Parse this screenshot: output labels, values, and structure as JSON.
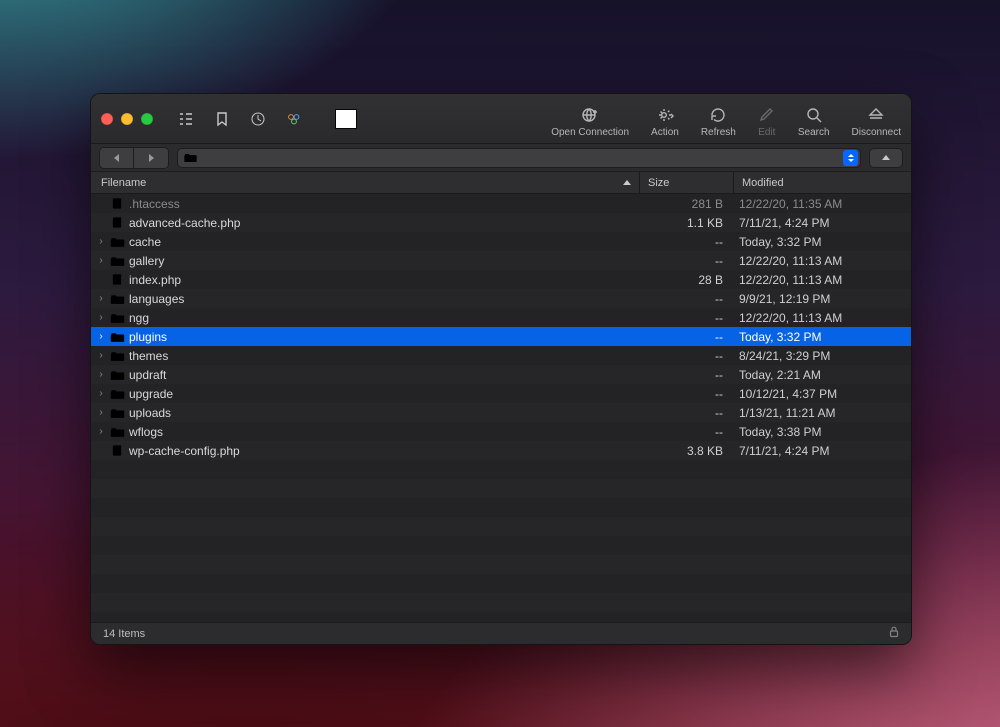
{
  "toolbar": {
    "open_connection": "Open Connection",
    "action": "Action",
    "refresh": "Refresh",
    "edit": "Edit",
    "search": "Search",
    "disconnect": "Disconnect"
  },
  "columns": {
    "filename": "Filename",
    "size": "Size",
    "modified": "Modified"
  },
  "files": [
    {
      "name": ".htaccess",
      "type": "file",
      "size": "281 B",
      "modified": "12/22/20, 11:35 AM",
      "dimmed": true
    },
    {
      "name": "advanced-cache.php",
      "type": "file",
      "size": "1.1 KB",
      "modified": "7/11/21, 4:24 PM"
    },
    {
      "name": "cache",
      "type": "folder",
      "size": "--",
      "modified": "Today, 3:32 PM"
    },
    {
      "name": "gallery",
      "type": "folder",
      "size": "--",
      "modified": "12/22/20, 11:13 AM"
    },
    {
      "name": "index.php",
      "type": "file",
      "size": "28 B",
      "modified": "12/22/20, 11:13 AM"
    },
    {
      "name": "languages",
      "type": "folder",
      "size": "--",
      "modified": "9/9/21, 12:19 PM"
    },
    {
      "name": "ngg",
      "type": "folder",
      "size": "--",
      "modified": "12/22/20, 11:13 AM"
    },
    {
      "name": "plugins",
      "type": "folder",
      "size": "--",
      "modified": "Today, 3:32 PM",
      "selected": true
    },
    {
      "name": "themes",
      "type": "folder",
      "size": "--",
      "modified": "8/24/21, 3:29 PM"
    },
    {
      "name": "updraft",
      "type": "folder",
      "size": "--",
      "modified": "Today, 2:21 AM"
    },
    {
      "name": "upgrade",
      "type": "folder",
      "size": "--",
      "modified": "10/12/21, 4:37 PM"
    },
    {
      "name": "uploads",
      "type": "folder",
      "size": "--",
      "modified": "1/13/21, 11:21 AM"
    },
    {
      "name": "wflogs",
      "type": "folder",
      "size": "--",
      "modified": "Today, 3:38 PM"
    },
    {
      "name": "wp-cache-config.php",
      "type": "file",
      "size": "3.8 KB",
      "modified": "7/11/21, 4:24 PM"
    }
  ],
  "status": {
    "item_count": "14 Items"
  }
}
